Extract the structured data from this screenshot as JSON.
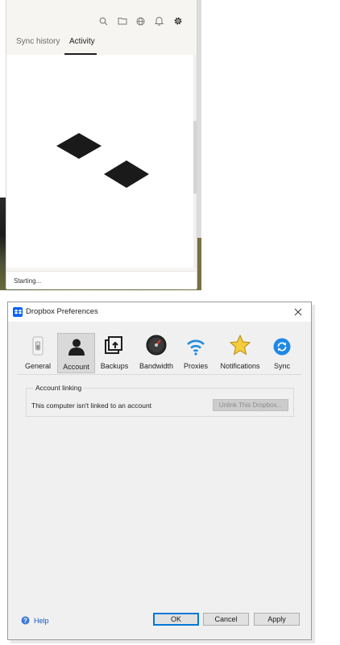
{
  "tray": {
    "tabs": [
      {
        "label": "Sync history"
      },
      {
        "label": "Activity"
      }
    ],
    "icons": [
      "search-icon",
      "folder-icon",
      "globe-icon",
      "bell-icon",
      "gear-icon"
    ],
    "status": "Starting..."
  },
  "dialog": {
    "title": "Dropbox Preferences",
    "toolbar": [
      {
        "label": "General",
        "icon": "general-switch-icon"
      },
      {
        "label": "Account",
        "icon": "account-person-icon",
        "selected": true
      },
      {
        "label": "Backups",
        "icon": "backups-icon"
      },
      {
        "label": "Bandwidth",
        "icon": "bandwidth-gauge-icon"
      },
      {
        "label": "Proxies",
        "icon": "wifi-icon"
      },
      {
        "label": "Notifications",
        "icon": "star-icon"
      },
      {
        "label": "Sync",
        "icon": "sync-icon"
      }
    ],
    "account_group": {
      "title": "Account linking",
      "text": "This computer isn't linked to an account",
      "unlink_label": "Unlink This Dropbox..."
    },
    "help_label": "Help",
    "ok_label": "OK",
    "cancel_label": "Cancel",
    "apply_label": "Apply"
  },
  "colors": {
    "dropbox_blue": "#0061fe",
    "accent_focus": "#0078d7",
    "help_link": "#1a56c7"
  }
}
